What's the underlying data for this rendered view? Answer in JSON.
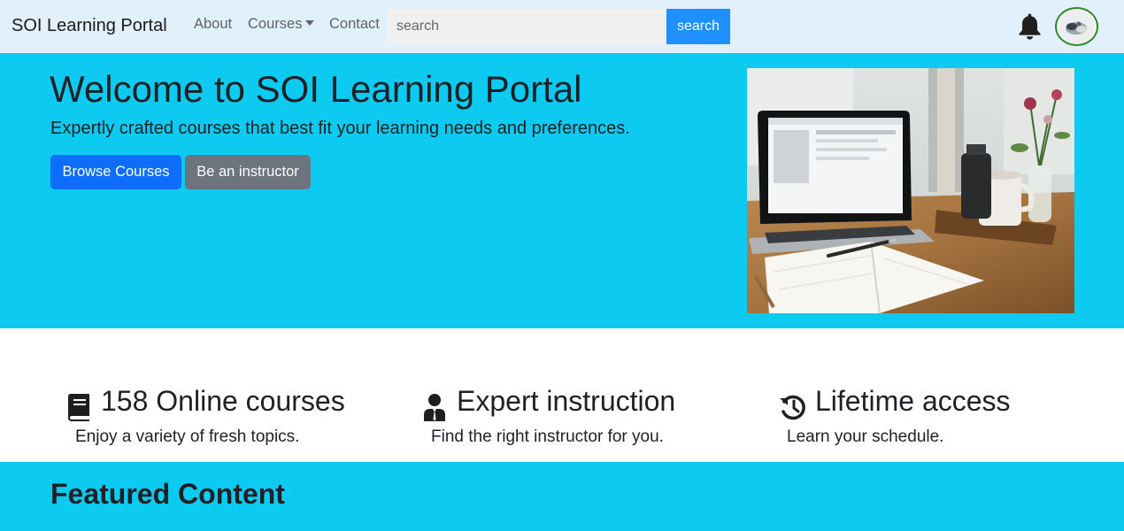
{
  "navbar": {
    "brand": "SOI Learning Portal",
    "links": [
      "About",
      "Courses",
      "Contact"
    ],
    "search_placeholder": "search",
    "search_button": "search",
    "bell_icon": "bell-icon",
    "avatar_icon": "avatar"
  },
  "hero": {
    "title": "Welcome to SOI Learning Portal",
    "subtitle": "Expertly crafted courses that best fit your learning needs and preferences.",
    "primary_button": "Browse Courses",
    "secondary_button": "Be an instructor",
    "image_icon": "laptop-notebook-photo",
    "bg_color": "#0dcaf0"
  },
  "features": [
    {
      "icon": "book-icon",
      "title": "158 Online courses",
      "text": "Enjoy a variety of fresh topics."
    },
    {
      "icon": "instructor-icon",
      "title": "Expert instruction",
      "text": "Find the right instructor for you."
    },
    {
      "icon": "history-icon",
      "title": "Lifetime access",
      "text": "Learn your schedule."
    }
  ],
  "featured": {
    "title": "Featured Content"
  },
  "colors": {
    "navbar_bg": "#e1f0fb",
    "primary": "#0d6efd",
    "secondary": "#6c757d",
    "search_button": "#1e90ff",
    "avatar_border": "#2a8a2a"
  }
}
